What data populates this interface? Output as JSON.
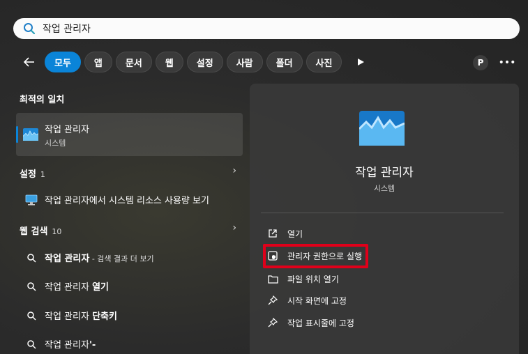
{
  "search": {
    "query": "작업 관리자"
  },
  "filters": [
    "모두",
    "앱",
    "문서",
    "웹",
    "설정",
    "사람",
    "폴더",
    "사진"
  ],
  "avatar_letter": "P",
  "best_match": {
    "heading": "최적의 일치",
    "name": "작업 관리자",
    "type": "시스템"
  },
  "settings_section": {
    "heading": "설정",
    "count": "1",
    "items": [
      "작업 관리자에서 시스템 리소스 사용량 보기"
    ]
  },
  "web_section": {
    "heading": "웹 검색",
    "count": "10",
    "items": [
      {
        "prefix": "작업 관리자",
        "suffix": " - 검색 결과 더 보기"
      },
      {
        "prefix": "작업 관리자 ",
        "bold": "열기"
      },
      {
        "prefix": "작업 관리자 ",
        "bold": "단축키"
      },
      {
        "prefix": "작업 관리자",
        "bold": "'-"
      }
    ]
  },
  "detail": {
    "title": "작업 관리자",
    "subtitle": "시스템",
    "actions": [
      "열기",
      "관리자 권한으로 실행",
      "파일 위치 열기",
      "시작 화면에 고정",
      "작업 표시줄에 고정"
    ]
  },
  "colors": {
    "accent": "#0a84d8",
    "highlight": "#e0001a"
  }
}
